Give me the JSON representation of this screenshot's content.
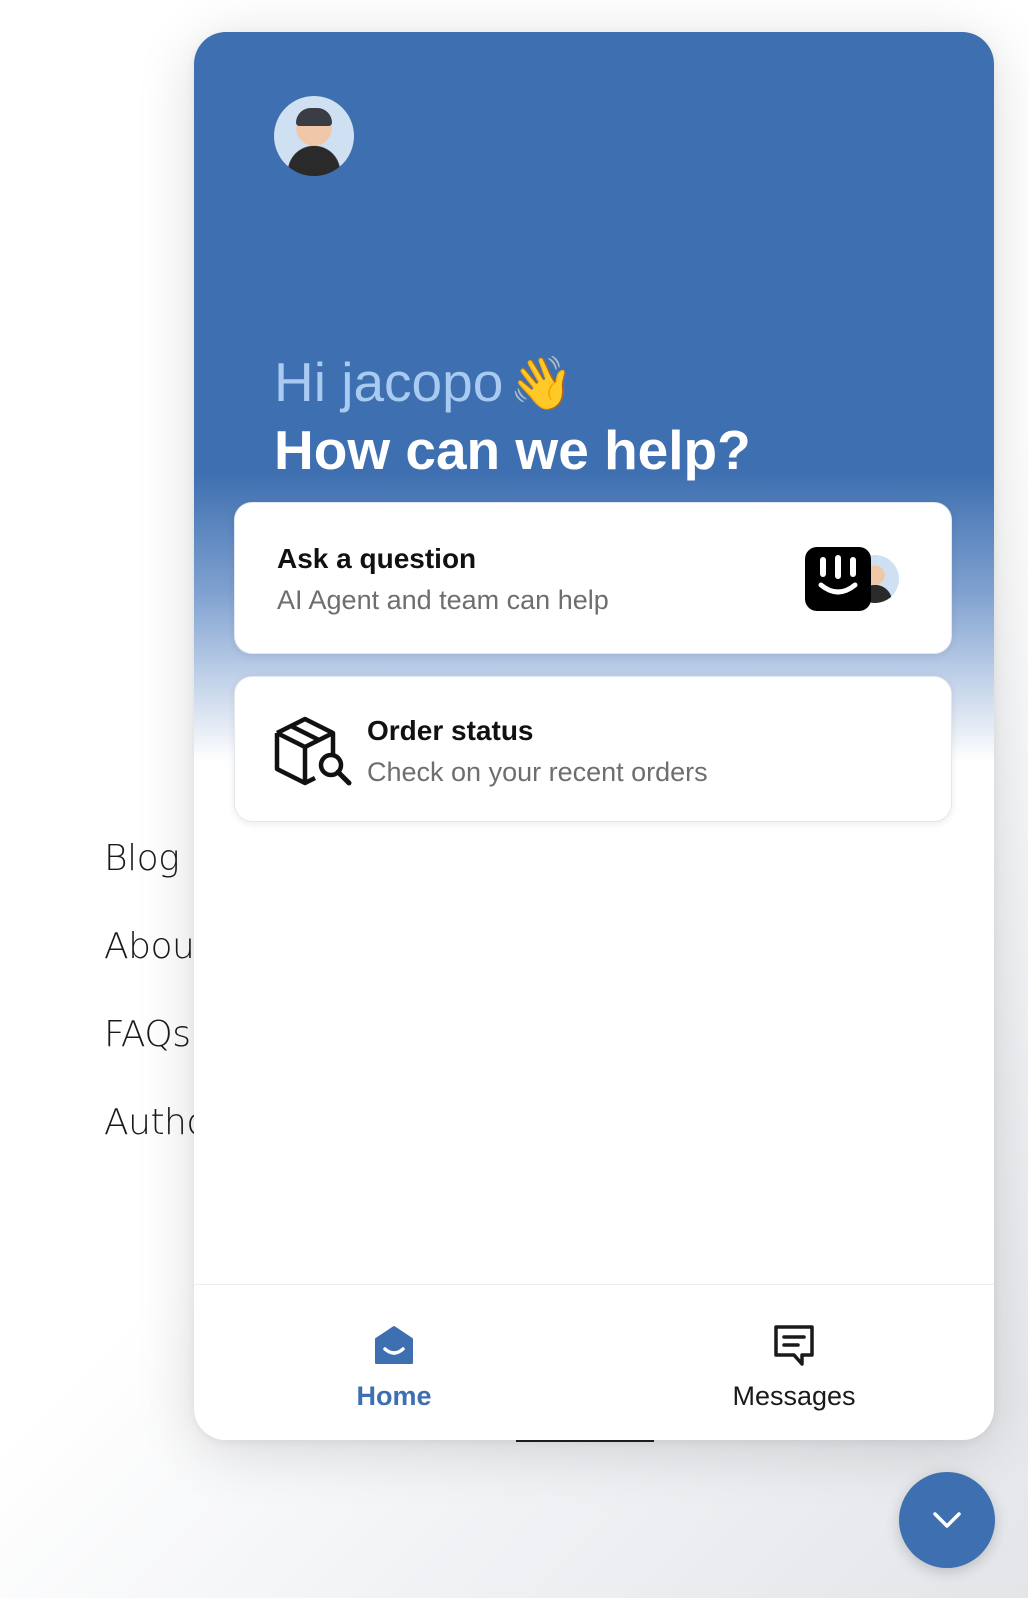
{
  "background_page": {
    "nav_items": [
      {
        "label": "Blog"
      },
      {
        "label": "About"
      },
      {
        "label": "FAQs"
      },
      {
        "label": "Authors"
      }
    ]
  },
  "messenger": {
    "greeting": "Hi jacopo",
    "greeting_emoji": "👋",
    "headline": "How can we help?",
    "cards": {
      "ask": {
        "title": "Ask a question",
        "subtitle": "AI Agent and team can help"
      },
      "order": {
        "title": "Order status",
        "subtitle": "Check on your recent orders"
      }
    },
    "tabs": {
      "home": "Home",
      "messages": "Messages"
    }
  },
  "colors": {
    "brand_blue": "#3e6fb0",
    "greeting_light_blue": "#a9cbf2"
  },
  "icons": {
    "order": "package-search-icon",
    "home": "home-icon",
    "messages": "chat-bubble-icon",
    "launcher": "chevron-down-icon"
  }
}
